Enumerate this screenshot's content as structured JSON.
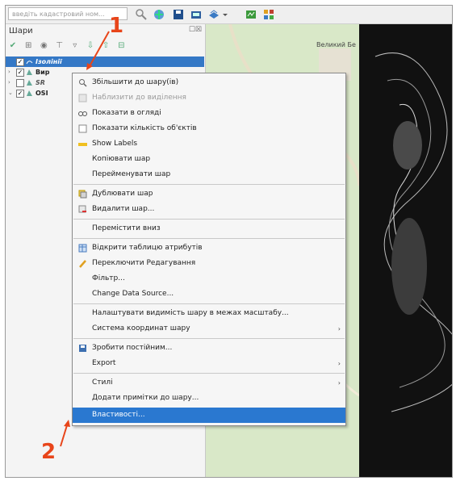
{
  "toolbar": {
    "search_placeholder": "введіть кадастровий ном..."
  },
  "layers_panel": {
    "title": "Шари",
    "window_buttons": "☐☒",
    "layers": [
      {
        "name": "Ізолінії",
        "checked": true,
        "selected": true,
        "expander": "",
        "icon": "contour-layer-icon"
      },
      {
        "name": "Вир",
        "checked": true,
        "selected": false,
        "expander": "›",
        "icon": "polygon-layer-icon"
      },
      {
        "name": "SR",
        "checked": false,
        "selected": false,
        "expander": "›",
        "icon": "raster-layer-icon"
      },
      {
        "name": "OSI",
        "checked": true,
        "selected": false,
        "expander": "⌄",
        "icon": "osm-layer-icon"
      }
    ]
  },
  "map": {
    "place_label": "Великий Бе"
  },
  "context_menu": {
    "items": [
      {
        "label": "Збільшити до шару(ів)",
        "icon": "zoom-icon",
        "dim": false
      },
      {
        "label": "Наблизити до виділення",
        "icon": "zoom-selection-icon",
        "dim": true
      },
      {
        "label": "Показати в огляді",
        "icon": "overview-icon",
        "dim": false
      },
      {
        "label": "Показати кількість об'єктів",
        "icon": "checkbox-icon",
        "dim": false
      },
      {
        "label": "Show Labels",
        "icon": "labels-icon",
        "dim": false
      },
      {
        "label": "Копіювати шар",
        "icon": "",
        "dim": false
      },
      {
        "label": "Перейменувати шар",
        "icon": "",
        "dim": false
      },
      {
        "label": "Дублювати шар",
        "icon": "duplicate-icon",
        "dim": false
      },
      {
        "label": "Видалити шар...",
        "icon": "remove-layer-icon",
        "dim": false
      },
      {
        "label": "Перемістити вниз",
        "icon": "",
        "dim": false
      },
      {
        "label": "Відкрити таблицю атрибутів",
        "icon": "table-icon",
        "dim": false
      },
      {
        "label": "Переключити Редагування",
        "icon": "pencil-icon",
        "dim": false
      },
      {
        "label": "Фільтр...",
        "icon": "",
        "dim": false
      },
      {
        "label": "Change Data Source...",
        "icon": "",
        "dim": false
      },
      {
        "label": "Налаштувати видимість шару в межах масштабу...",
        "icon": "",
        "dim": false
      },
      {
        "label": "Система координат шару",
        "icon": "",
        "dim": false,
        "submenu": true
      },
      {
        "label": "Зробити постійним...",
        "icon": "save-icon",
        "dim": false
      },
      {
        "label": "Export",
        "icon": "",
        "dim": false,
        "submenu": true
      },
      {
        "label": "Стилі",
        "icon": "",
        "dim": false,
        "submenu": true
      },
      {
        "label": "Додати примітки до шару...",
        "icon": "",
        "dim": false
      },
      {
        "label": "Властивості...",
        "icon": "",
        "dim": false,
        "highlighted": true
      }
    ]
  },
  "annotations": {
    "step1": "1",
    "step2": "2",
    "color": "#e8451a"
  }
}
